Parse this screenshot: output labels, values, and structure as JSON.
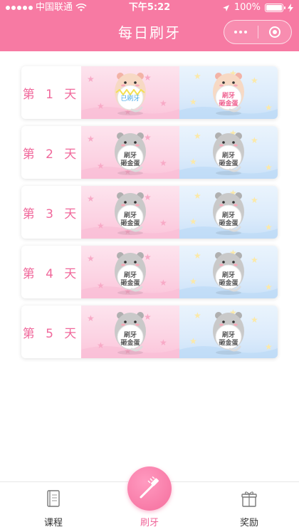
{
  "status_bar": {
    "carrier": "中国联通",
    "time": "下午5:22",
    "battery": "100%"
  },
  "nav": {
    "title": "每日刷牙"
  },
  "days": [
    {
      "label": "第 1 天",
      "morning_text": "已刷牙",
      "morning_done": true,
      "evening_text": "刷牙\n砸金蛋",
      "evening_done": false
    },
    {
      "label": "第 2 天",
      "morning_text": "刷牙\n砸金蛋",
      "morning_done": false,
      "evening_text": "刷牙\n砸金蛋",
      "evening_done": false
    },
    {
      "label": "第 3 天",
      "morning_text": "刷牙\n砸金蛋",
      "morning_done": false,
      "evening_text": "刷牙\n砸金蛋",
      "evening_done": false
    },
    {
      "label": "第 4 天",
      "morning_text": "刷牙\n砸金蛋",
      "morning_done": false,
      "evening_text": "刷牙\n砸金蛋",
      "evening_done": false
    },
    {
      "label": "第 5 天",
      "morning_text": "刷牙\n砸金蛋",
      "morning_done": false,
      "evening_text": "刷牙\n砸金蛋",
      "evening_done": false
    }
  ],
  "tabs": [
    {
      "label": "课程",
      "icon": "book-icon"
    },
    {
      "label": "刷牙",
      "icon": "toothbrush-icon"
    },
    {
      "label": "奖励",
      "icon": "gift-icon"
    }
  ],
  "colors": {
    "brand_pink": "#f77aa3",
    "day_label": "#f0689b",
    "done_text": "#4aa8e8"
  }
}
